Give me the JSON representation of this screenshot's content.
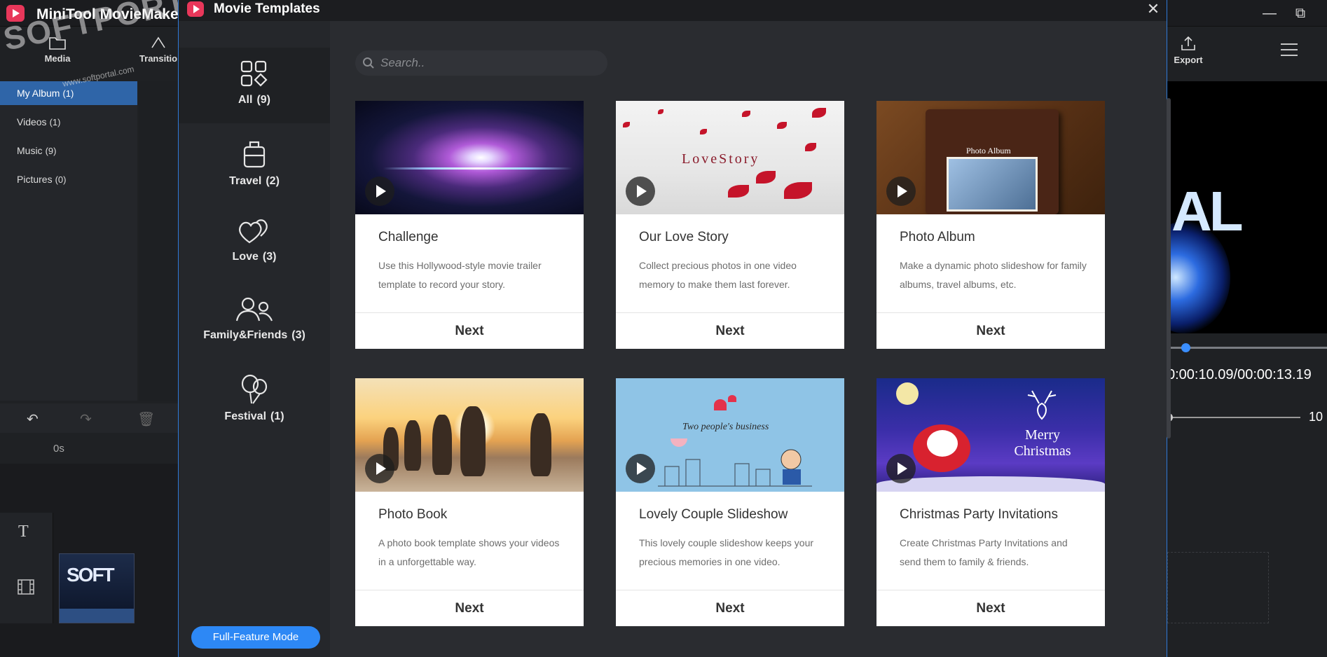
{
  "app": {
    "title": "MiniTool MovieMaker",
    "toolbar": {
      "media_label": "Media",
      "transition_label": "Transitio",
      "export_label": "Export"
    },
    "media_library": [
      {
        "label": "My Album",
        "count": "(1)"
      },
      {
        "label": "Videos",
        "count": "(1)"
      },
      {
        "label": "Music",
        "count": "(9)"
      },
      {
        "label": "Pictures",
        "count": "(0)"
      }
    ],
    "preview": {
      "time_readout": "0:00:10.09/00:00:13.19",
      "volume_value": "10",
      "preview_letters": "AL"
    },
    "timeline": {
      "ruler_start": "0s",
      "clip_glyphs": "SOFT"
    },
    "watermark": {
      "text": "SOFTPORTAL",
      "sub": "www.softportal.com"
    }
  },
  "modal": {
    "title": "Movie Templates",
    "close_glyph": "✕",
    "search_placeholder": "Search..",
    "categories": [
      {
        "label": "All",
        "count": "(9)",
        "icon": "grid-icon"
      },
      {
        "label": "Travel",
        "count": "(2)",
        "icon": "luggage-icon"
      },
      {
        "label": "Love",
        "count": "(3)",
        "icon": "hearts-icon"
      },
      {
        "label": "Family&Friends",
        "count": "(3)",
        "icon": "people-icon"
      },
      {
        "label": "Festival",
        "count": "(1)",
        "icon": "balloons-icon"
      }
    ],
    "full_feature_label": "Full-Feature Mode",
    "templates": [
      {
        "title": "Challenge",
        "desc": "Use this Hollywood-style movie trailer template to record your story.",
        "next": "Next"
      },
      {
        "title": "Our Love Story",
        "desc": "Collect precious photos in one video memory to make them last forever.",
        "next": "Next",
        "thumb_text": "LoveStory"
      },
      {
        "title": "Photo Album",
        "desc": "Make a dynamic photo slideshow for family albums, travel albums, etc.",
        "next": "Next",
        "thumb_text": "Photo Album"
      },
      {
        "title": "Photo Book",
        "desc": "A photo book template shows your videos in a unforgettable way.",
        "next": "Next"
      },
      {
        "title": "Lovely Couple Slideshow",
        "desc": "This lovely couple slideshow keeps your precious memories in one video.",
        "next": "Next",
        "thumb_text": "Two people's business"
      },
      {
        "title": "Christmas Party Invitations",
        "desc": "Create Christmas Party Invitations and send them to family & friends.",
        "next": "Next",
        "thumb_text": "Merry Christmas"
      }
    ]
  },
  "colors": {
    "accent": "#2d88f5",
    "brand": "#e8375a",
    "dialog_border": "#2f7ad8"
  }
}
